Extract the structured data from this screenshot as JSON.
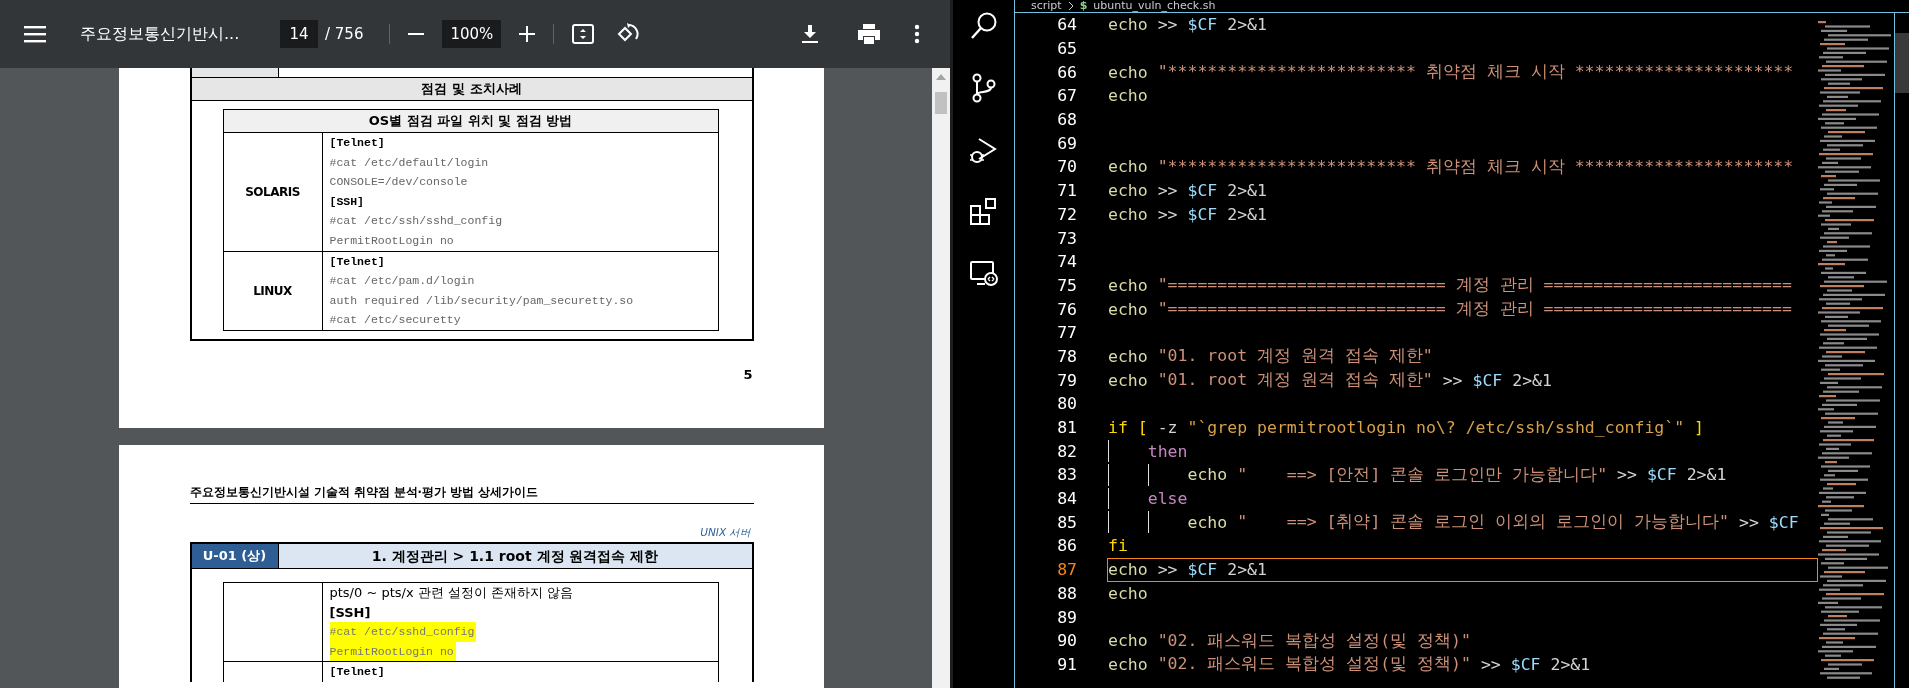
{
  "pdf_viewer": {
    "title": "주요정보통신기반시...",
    "page_input": "14",
    "page_total": "/ 756",
    "zoom": "100%",
    "page_top": {
      "section_header": "점검 및 조치사례",
      "inner_header": "OS별 점검 파일 위치 및 점검 방법",
      "page_number": "5",
      "rows": [
        {
          "label": "SOLARIS",
          "lines": [
            {
              "kind": "code-heading",
              "text": "[Telnet]",
              "highlighted": false
            },
            {
              "kind": "code",
              "text": "#cat /etc/default/login",
              "highlighted": false
            },
            {
              "kind": "code",
              "text": "CONSOLE=/dev/console",
              "highlighted": false
            },
            {
              "kind": "code-heading",
              "text": "[SSH]",
              "highlighted": false
            },
            {
              "kind": "code",
              "text": "#cat /etc/ssh/sshd_config",
              "highlighted": false
            },
            {
              "kind": "code",
              "text": "PermitRootLogin no",
              "highlighted": false
            }
          ]
        },
        {
          "label": "LINUX",
          "lines": [
            {
              "kind": "code-heading",
              "text": "[Telnet]",
              "highlighted": false
            },
            {
              "kind": "code",
              "text": "#cat /etc/pam.d/login",
              "highlighted": false
            },
            {
              "kind": "code",
              "text": "auth required /lib/security/pam_securetty.so",
              "highlighted": false
            },
            {
              "kind": "code",
              "text": "#cat /etc/securetty",
              "highlighted": false
            }
          ]
        }
      ]
    },
    "page_bottom": {
      "running_header": "주요정보통신기반시설 기술적 취약점 분석·평가 방법 상세가이드",
      "category": "UNIX 서버",
      "item_code": "U-01 (상)",
      "item_title": "1. 계정관리 > 1.1 root 계정 원격접속 제한",
      "rows": [
        {
          "lines": [
            {
              "kind": "text",
              "text": "pts/0 ~ pts/x 관련 설정이 존재하지 않음",
              "highlighted": false
            },
            {
              "kind": "text-heading",
              "text": "[SSH]",
              "highlighted": false
            },
            {
              "kind": "code",
              "text": "#cat /etc/sshd_config",
              "highlighted": true
            },
            {
              "kind": "code",
              "text": "PermitRootLogin no",
              "highlighted": true
            }
          ]
        },
        {
          "lines": [
            {
              "kind": "code-heading",
              "text": "[Telnet]",
              "highlighted": false
            }
          ]
        }
      ]
    }
  },
  "editor": {
    "breadcrumb": [
      {
        "text": "script",
        "kind": "folder"
      },
      {
        "text": "ubuntu_vuln_check.sh",
        "kind": "file",
        "icon": "$"
      }
    ],
    "lines": [
      {
        "number": "64",
        "current": false,
        "tokens": [
          {
            "kind": "command",
            "text": "echo"
          },
          {
            "kind": "plain",
            "text": " >> "
          },
          {
            "kind": "variable",
            "text": "$CF"
          },
          {
            "kind": "plain",
            "text": " 2>&1"
          }
        ]
      },
      {
        "number": "65",
        "current": false
      },
      {
        "number": "66",
        "current": false,
        "tokens": [
          {
            "kind": "command",
            "text": "echo "
          },
          {
            "kind": "string",
            "text": "\"************************* 취약점 체크 시작 **********************"
          }
        ]
      },
      {
        "number": "67",
        "current": false,
        "tokens": [
          {
            "kind": "command",
            "text": "echo"
          }
        ]
      },
      {
        "number": "68",
        "current": false
      },
      {
        "number": "69",
        "current": false
      },
      {
        "number": "70",
        "current": false,
        "tokens": [
          {
            "kind": "command",
            "text": "echo "
          },
          {
            "kind": "string",
            "text": "\"************************* 취약점 체크 시작 **********************"
          }
        ]
      },
      {
        "number": "71",
        "current": false,
        "tokens": [
          {
            "kind": "command",
            "text": "echo"
          },
          {
            "kind": "plain",
            "text": " >> "
          },
          {
            "kind": "variable",
            "text": "$CF"
          },
          {
            "kind": "plain",
            "text": " 2>&1"
          }
        ]
      },
      {
        "number": "72",
        "current": false,
        "tokens": [
          {
            "kind": "command",
            "text": "echo"
          },
          {
            "kind": "plain",
            "text": " >> "
          },
          {
            "kind": "variable",
            "text": "$CF"
          },
          {
            "kind": "plain",
            "text": " 2>&1"
          }
        ]
      },
      {
        "number": "73",
        "current": false
      },
      {
        "number": "74",
        "current": false
      },
      {
        "number": "75",
        "current": false,
        "tokens": [
          {
            "kind": "command",
            "text": "echo "
          },
          {
            "kind": "string",
            "text": "\"============================ 계정 관리 ========================="
          }
        ]
      },
      {
        "number": "76",
        "current": false,
        "tokens": [
          {
            "kind": "command",
            "text": "echo "
          },
          {
            "kind": "string",
            "text": "\"============================ 계정 관리 ========================="
          }
        ]
      },
      {
        "number": "77",
        "current": false
      },
      {
        "number": "78",
        "current": false,
        "tokens": [
          {
            "kind": "command",
            "text": "echo "
          },
          {
            "kind": "string",
            "text": "\"01. root 계정 원격 접속 제한\""
          }
        ]
      },
      {
        "number": "79",
        "current": false,
        "tokens": [
          {
            "kind": "command",
            "text": "echo "
          },
          {
            "kind": "string",
            "text": "\"01. root 계정 원격 접속 제한\""
          },
          {
            "kind": "plain",
            "text": " >> "
          },
          {
            "kind": "variable",
            "text": "$CF"
          },
          {
            "kind": "plain",
            "text": " 2>&1"
          }
        ]
      },
      {
        "number": "80",
        "current": false
      },
      {
        "number": "81",
        "current": false,
        "tokens": [
          {
            "kind": "keyword",
            "text": "if [ "
          },
          {
            "kind": "plain",
            "text": "-z "
          },
          {
            "kind": "substitution",
            "text": "\"`grep permitrootlogin no\\? /etc/ssh/sshd_config`\""
          },
          {
            "kind": "keyword",
            "text": " ]"
          }
        ],
        "children": [
          {
            "number": "82",
            "current": false,
            "tokens": [
              {
                "kind": "control",
                "text": "then"
              }
            ],
            "children": [
              {
                "number": "83",
                "current": false,
                "tokens": [
                  {
                    "kind": "command",
                    "text": "echo "
                  },
                  {
                    "kind": "string",
                    "text": "\"    ==> [안전] 콘솔 로그인만 가능합니다\""
                  },
                  {
                    "kind": "plain",
                    "text": " >> "
                  },
                  {
                    "kind": "variable",
                    "text": "$CF"
                  },
                  {
                    "kind": "plain",
                    "text": " 2>&1"
                  }
                ]
              }
            ]
          },
          {
            "number": "84",
            "current": false,
            "tokens": [
              {
                "kind": "control",
                "text": "else"
              }
            ],
            "children": [
              {
                "number": "85",
                "current": false,
                "tokens": [
                  {
                    "kind": "command",
                    "text": "echo "
                  },
                  {
                    "kind": "string",
                    "text": "\"    ==> [취약] 콘솔 로그인 이외의 로그인이 가능합니다\""
                  },
                  {
                    "kind": "plain",
                    "text": " >> "
                  },
                  {
                    "kind": "variable",
                    "text": "$CF"
                  }
                ]
              }
            ]
          }
        ]
      },
      {
        "number": "86",
        "current": false,
        "tokens": [
          {
            "kind": "keyword",
            "text": "fi"
          }
        ]
      },
      {
        "number": "87",
        "current": true,
        "tokens": [
          {
            "kind": "command",
            "text": "echo"
          },
          {
            "kind": "plain",
            "text": " >> "
          },
          {
            "kind": "variable",
            "text": "$CF"
          },
          {
            "kind": "plain",
            "text": " 2>&1"
          }
        ]
      },
      {
        "number": "88",
        "current": false,
        "tokens": [
          {
            "kind": "command",
            "text": "echo"
          }
        ]
      },
      {
        "number": "89",
        "current": false
      },
      {
        "number": "90",
        "current": false,
        "tokens": [
          {
            "kind": "command",
            "text": "echo "
          },
          {
            "kind": "string",
            "text": "\"02. 패스워드 복합성 설정(및 정책)\""
          }
        ]
      },
      {
        "number": "91",
        "current": false,
        "tokens": [
          {
            "kind": "command",
            "text": "echo "
          },
          {
            "kind": "string",
            "text": "\"02. 패스워드 복합성 설정(및 정책)\""
          },
          {
            "kind": "plain",
            "text": " >> "
          },
          {
            "kind": "variable",
            "text": "$CF"
          },
          {
            "kind": "plain",
            "text": " 2>&1"
          }
        ]
      }
    ]
  }
}
